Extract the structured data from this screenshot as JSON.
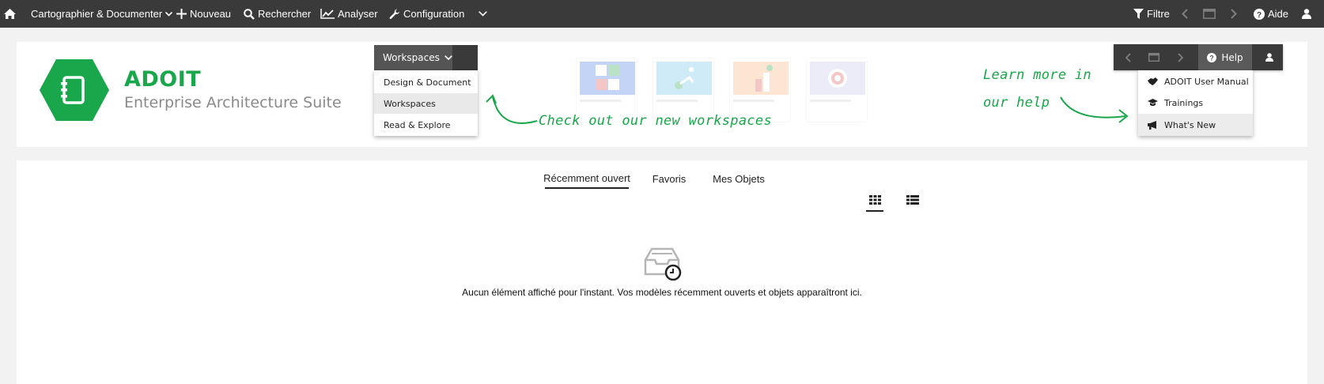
{
  "toolbar": {
    "cartographier": "Cartographier & Documenter",
    "nouveau": "Nouveau",
    "rechercher": "Rechercher",
    "analyser": "Analyser",
    "configuration": "Configuration",
    "filtre": "Filtre",
    "aide": "Aide"
  },
  "banner": {
    "title": "ADOIT",
    "subtitle": "Enterprise Architecture Suite",
    "brand_color": "#1aa64a",
    "workspaces_button": "Workspaces",
    "workspace_items": [
      {
        "label": "Design & Document"
      },
      {
        "label": "Workspaces"
      },
      {
        "label": "Read & Explore"
      }
    ],
    "callout_workspaces": "Check out our new workspaces",
    "callout_help_line1": "Learn more in",
    "callout_help_line2": "our help",
    "help_button": "Help",
    "help_items": [
      {
        "label": "ADOIT User Manual",
        "icon": "handshake-icon"
      },
      {
        "label": "Trainings",
        "icon": "graduation-cap-icon"
      },
      {
        "label": "What's New",
        "icon": "megaphone-icon"
      }
    ]
  },
  "main": {
    "tabs": [
      {
        "label": "Récemment ouvert",
        "active": true
      },
      {
        "label": "Favoris",
        "active": false
      },
      {
        "label": "Mes Objets",
        "active": false
      }
    ],
    "view_modes": [
      {
        "icon": "grid-view-icon",
        "active": true
      },
      {
        "icon": "list-view-icon",
        "active": false
      }
    ],
    "empty_message": "Aucun élément affiché pour l'instant. Vos modèles récemment ouverts et objets apparaîtront ici."
  }
}
